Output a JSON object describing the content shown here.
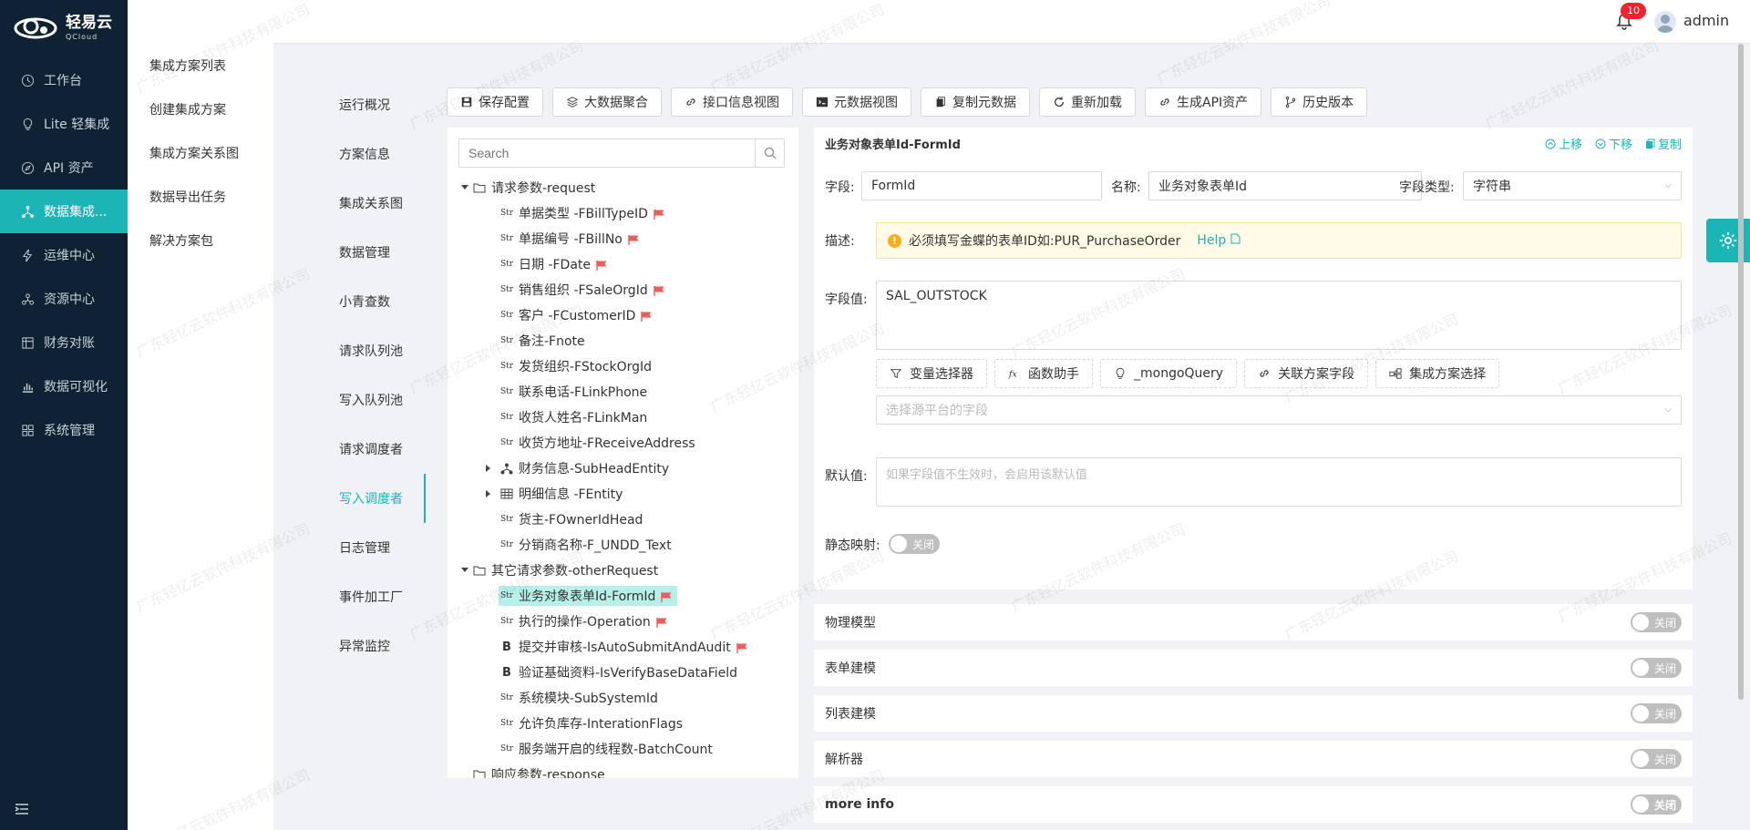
{
  "brand": {
    "name_cn": "轻易云",
    "name_en": "QCloud"
  },
  "sidebar": {
    "items": [
      {
        "label": "工作台",
        "icon": "clock-icon"
      },
      {
        "label": "Lite 轻集成",
        "icon": "bulb-icon"
      },
      {
        "label": "API 资产",
        "icon": "compass-icon"
      },
      {
        "label": "数据集成...",
        "icon": "network-icon",
        "active": true
      },
      {
        "label": "运维中心",
        "icon": "bolt-icon"
      },
      {
        "label": "资源中心",
        "icon": "cluster-icon"
      },
      {
        "label": "财务对账",
        "icon": "ledger-icon"
      },
      {
        "label": "数据可视化",
        "icon": "chart-icon"
      },
      {
        "label": "系统管理",
        "icon": "grid-icon"
      }
    ]
  },
  "subnav": {
    "items": [
      "集成方案列表",
      "创建集成方案",
      "集成方案关系图",
      "数据导出任务",
      "解决方案包"
    ]
  },
  "header": {
    "notifications": "10",
    "username": "admin"
  },
  "tabs": {
    "items": [
      "运行概况",
      "方案信息",
      "集成关系图",
      "数据管理",
      "小青查数",
      "请求队列池",
      "写入队列池",
      "请求调度者",
      "写入调度者",
      "日志管理",
      "事件加工厂",
      "异常监控"
    ],
    "active": "写入调度者"
  },
  "toolbar": {
    "buttons": [
      {
        "label": "保存配置",
        "icon": "save-icon"
      },
      {
        "label": "大数据聚合",
        "icon": "layers-icon"
      },
      {
        "label": "接口信息视图",
        "icon": "link-icon"
      },
      {
        "label": "元数据视图",
        "icon": "terminal-icon"
      },
      {
        "label": "复制元数据",
        "icon": "copy-icon"
      },
      {
        "label": "重新加载",
        "icon": "reload-icon"
      },
      {
        "label": "生成API资产",
        "icon": "link-icon"
      },
      {
        "label": "历史版本",
        "icon": "branch-icon"
      }
    ]
  },
  "tree": {
    "search_placeholder": "Search",
    "rows": [
      {
        "label": "请求参数-request",
        "level": 0,
        "type": "folder",
        "arrow": "down"
      },
      {
        "label": "单据类型 -FBillTypeID",
        "level": 1,
        "type": "str",
        "flag": true
      },
      {
        "label": "单据编号 -FBillNo",
        "level": 1,
        "type": "str",
        "flag": true
      },
      {
        "label": "日期 -FDate",
        "level": 1,
        "type": "str",
        "flag": true
      },
      {
        "label": "销售组织 -FSaleOrgId",
        "level": 1,
        "type": "str",
        "flag": true
      },
      {
        "label": "客户 -FCustomerID",
        "level": 1,
        "type": "str",
        "flag": true
      },
      {
        "label": "备注-Fnote",
        "level": 1,
        "type": "str"
      },
      {
        "label": "发货组织-FStockOrgId",
        "level": 1,
        "type": "str"
      },
      {
        "label": "联系电话-FLinkPhone",
        "level": 1,
        "type": "str"
      },
      {
        "label": "收货人姓名-FLinkMan",
        "level": 1,
        "type": "str"
      },
      {
        "label": "收货方地址-FReceiveAddress",
        "level": 1,
        "type": "str"
      },
      {
        "label": "财务信息-SubHeadEntity",
        "level": 1,
        "type": "object",
        "arrow": "right"
      },
      {
        "label": "明细信息 -FEntity",
        "level": 1,
        "type": "array",
        "arrow": "right"
      },
      {
        "label": "货主-FOwnerIdHead",
        "level": 1,
        "type": "str"
      },
      {
        "label": "分销商名称-F_UNDD_Text",
        "level": 1,
        "type": "str"
      },
      {
        "label": "其它请求参数-otherRequest",
        "level": 0,
        "type": "folder",
        "arrow": "down"
      },
      {
        "label": "业务对象表单Id-FormId",
        "level": 1,
        "type": "str",
        "flag": true,
        "selected": true
      },
      {
        "label": "执行的操作-Operation",
        "level": 1,
        "type": "str",
        "flag": true
      },
      {
        "label": "提交并审核-IsAutoSubmitAndAudit",
        "level": 1,
        "type": "bool",
        "flag": true
      },
      {
        "label": "验证基础资料-IsVerifyBaseDataField",
        "level": 1,
        "type": "bool"
      },
      {
        "label": "系统模块-SubSystemId",
        "level": 1,
        "type": "str"
      },
      {
        "label": "允许负库存-InterationFlags",
        "level": 1,
        "type": "str"
      },
      {
        "label": "服务端开启的线程数-BatchCount",
        "level": 1,
        "type": "str"
      },
      {
        "label": "响应参数-response",
        "level": 0,
        "type": "folder"
      }
    ]
  },
  "form": {
    "title": "业务对象表单Id-FormId",
    "actions": {
      "up": "上移",
      "down": "下移",
      "copy": "复制"
    },
    "field_label": "字段:",
    "field_value": "FormId",
    "name_label": "名称:",
    "name_value": "业务对象表单Id",
    "type_label": "字段类型:",
    "type_value": "字符串",
    "desc_label": "描述:",
    "desc_text": "必须填写金蝶的表单ID如:PUR_PurchaseOrder",
    "desc_help": "Help",
    "value_label": "字段值:",
    "value_text": "SAL_OUTSTOCK",
    "helpers": [
      {
        "label": "变量选择器",
        "icon": "filter-icon"
      },
      {
        "label": "函数助手",
        "icon": "fx-icon"
      },
      {
        "label": "_mongoQuery",
        "icon": "bulb-icon"
      },
      {
        "label": "关联方案字段",
        "icon": "link-icon"
      },
      {
        "label": "集成方案选择",
        "icon": "nodes-icon"
      }
    ],
    "source_placeholder": "选择源平台的字段",
    "default_label": "默认值:",
    "default_placeholder": "如果字段值不生效时，会启用该默认值",
    "static_label": "静态映射:",
    "switch_off": "关闭"
  },
  "sections": [
    {
      "label": "物理模型",
      "state": "关闭"
    },
    {
      "label": "表单建模",
      "state": "关闭"
    },
    {
      "label": "列表建模",
      "state": "关闭"
    },
    {
      "label": "解析器",
      "state": "关闭"
    },
    {
      "label": "more info",
      "state": "关闭"
    }
  ],
  "watermark": "广东轻亿云软件科技有限公司",
  "colors": {
    "accent": "#1bb5b6",
    "sidebar_bg": "#0f2233",
    "flag": "#f05a5a",
    "selected": "#b6f0e8"
  }
}
